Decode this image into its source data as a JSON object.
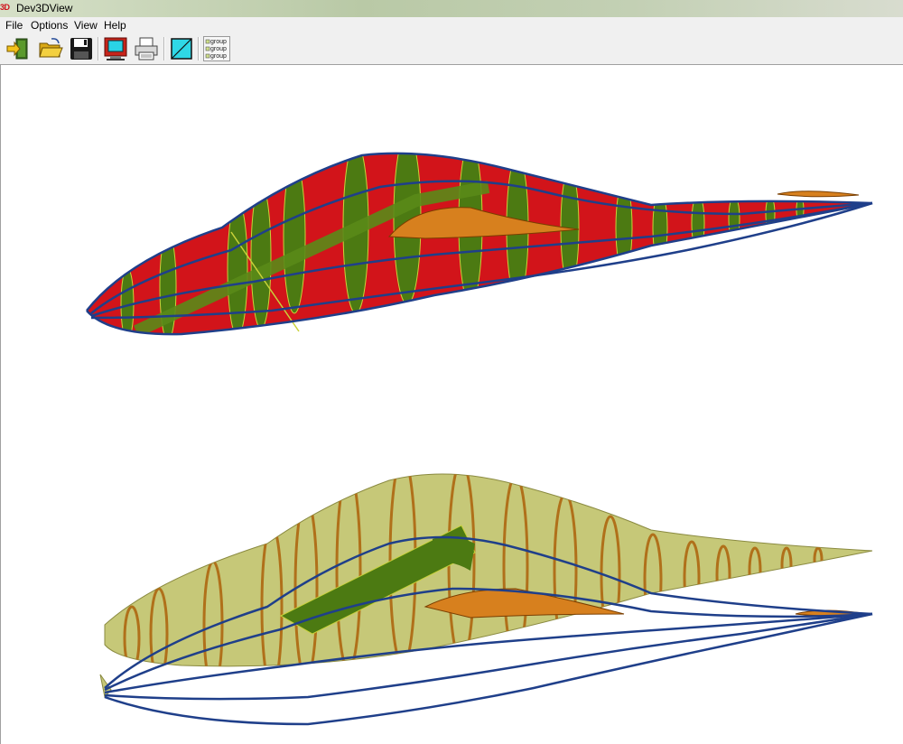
{
  "window": {
    "title": "Dev3DView",
    "icon_text": "3D"
  },
  "menu": [
    {
      "label": "File"
    },
    {
      "label": "Options"
    },
    {
      "label": "View"
    },
    {
      "label": "Help"
    }
  ],
  "toolbar": {
    "buttons": [
      {
        "icon": "exit-door-icon"
      },
      {
        "icon": "open-folder-icon"
      },
      {
        "icon": "save-disk-icon"
      },
      {
        "icon": "display-monitor-icon"
      },
      {
        "icon": "printer-icon"
      },
      {
        "icon": "color-swatch-icon"
      },
      {
        "icon": "group-list-icon",
        "lines": [
          "group",
          "group",
          "group"
        ]
      }
    ]
  },
  "models": [
    {
      "name": "fuselage-solid-view",
      "skin_color": "#d2141a",
      "frame_color": "#4c7a12",
      "wire_color": "#1f3f8a",
      "wing_color": "#d7801e"
    },
    {
      "name": "fuselage-skeleton-view",
      "skin_color": "#c6c878",
      "frame_color": "#4c7a12",
      "wire_color": "#1f3f8a",
      "wing_color": "#d7801e"
    }
  ]
}
